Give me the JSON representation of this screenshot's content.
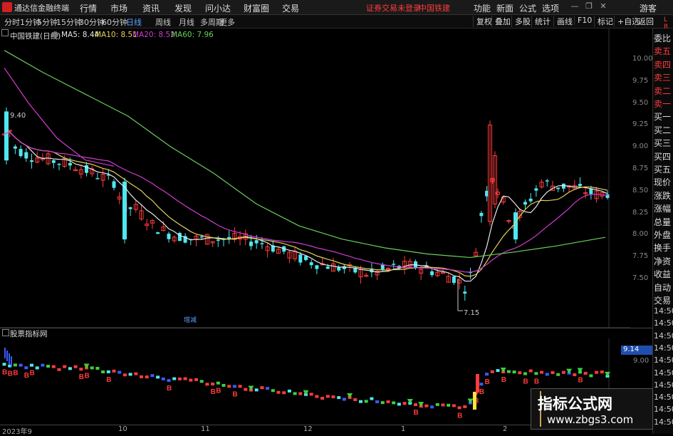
{
  "app": {
    "title": "通达信金融终端",
    "menu": [
      "行情",
      "市场",
      "资讯",
      "发现",
      "问小达",
      "财富圈",
      "交易"
    ],
    "notice": "证券交易未登录",
    "stock_tab": "中国铁建",
    "right_menu": [
      "功能",
      "新面",
      "公式",
      "选项"
    ],
    "guest": "游客",
    "window_controls": [
      "—",
      "❐",
      "✕"
    ]
  },
  "toolbar": {
    "periods": [
      "分时",
      "1分钟",
      "5分钟",
      "15分钟",
      "30分钟",
      "60分钟",
      "日线",
      "周线",
      "月线",
      "多周期",
      "更多"
    ],
    "selected": "日线",
    "right": [
      "复权",
      "叠加",
      "多股",
      "统计",
      "画线",
      "F10",
      "标记",
      "+自选",
      "返回"
    ]
  },
  "main_chart": {
    "stock_label": "中国铁建(日线)",
    "ma": [
      {
        "label": "MA5: 8.44",
        "color": "#e8e8e8"
      },
      {
        "label": "MA10: 8.51",
        "color": "#e6d25a"
      },
      {
        "label": "MA20: 8.52",
        "color": "#d23cd2"
      },
      {
        "label": "MA60: 7.96",
        "color": "#6ad05a"
      }
    ],
    "price_ticks": [
      "10.00",
      "9.75",
      "9.50",
      "9.25",
      "9.00",
      "8.75",
      "8.50",
      "8.25",
      "8.00",
      "7.75",
      "7.50"
    ],
    "high_label": "9.40",
    "low_label": "7.15",
    "marker": "增减"
  },
  "sub_chart": {
    "name": "股票指标网",
    "value_label": "9.14",
    "tick": "9.00"
  },
  "date_axis": [
    "2023年9",
    "10",
    "11",
    "12",
    "1",
    "2"
  ],
  "sidebar": {
    "items": [
      "委比",
      "卖五",
      "卖四",
      "卖三",
      "卖二",
      "卖一",
      "买一",
      "买二",
      "买三",
      "买四",
      "买五",
      "现价",
      "涨跌",
      "涨幅",
      "总量",
      "外盘",
      "换手",
      "净资",
      "收益",
      "自动",
      "交易"
    ],
    "times": [
      "14:50",
      "14:50",
      "14:50",
      "14:50",
      "14:50",
      "14:50",
      "14:50",
      "14:50",
      "14:50",
      "14:50"
    ],
    "scroll_labels": [
      "L",
      "R"
    ]
  },
  "watermark": {
    "title": "指标公式网",
    "url": "www.zbgs3.com"
  },
  "colors": {
    "up": "#ff3b3b",
    "down": "#4ee8f0",
    "ma5": "#e8e8e8",
    "ma10": "#e6d25a",
    "ma20": "#d23cd2",
    "ma60": "#6ad05a"
  }
}
